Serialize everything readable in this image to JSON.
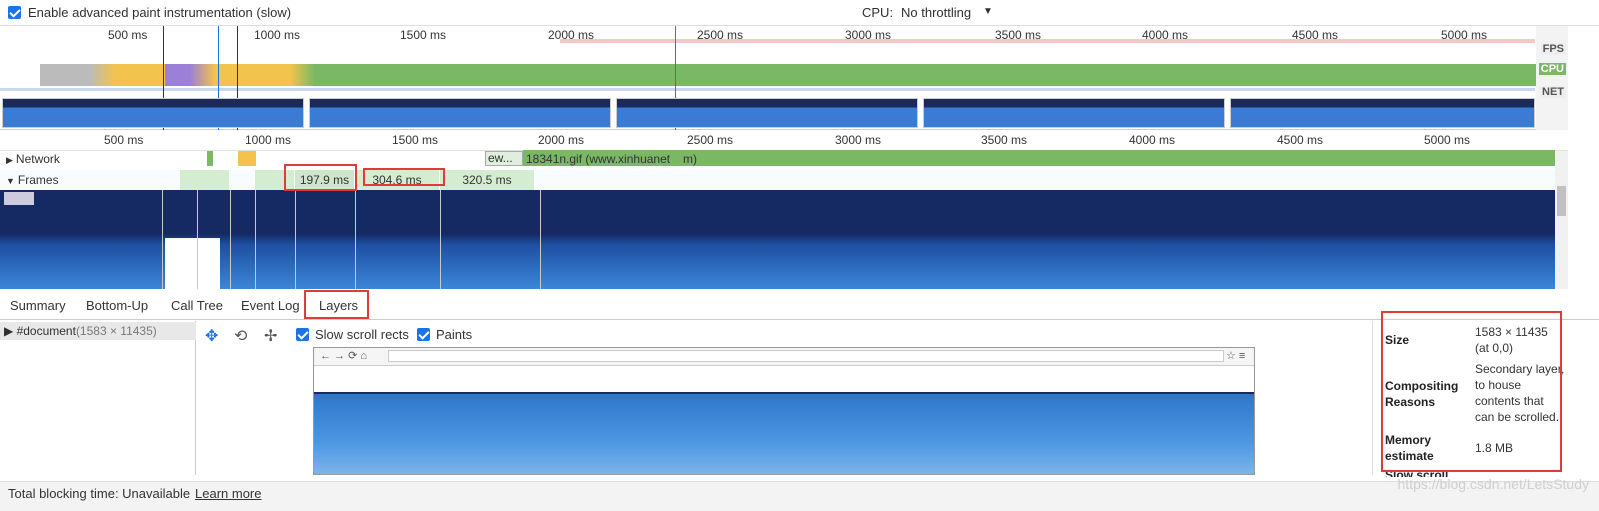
{
  "toolbar": {
    "paint_instrumentation_label": "Enable advanced paint instrumentation (slow)",
    "cpu_label": "CPU:",
    "cpu_value": "No throttling"
  },
  "overview": {
    "ticks": [
      "500 ms",
      "1000 ms",
      "1500 ms",
      "2000 ms",
      "2500 ms",
      "3000 ms",
      "3500 ms",
      "4000 ms",
      "4500 ms",
      "5000 ms"
    ],
    "labels": {
      "fps": "FPS",
      "cpu": "CPU",
      "net": "NET"
    }
  },
  "details_ruler": {
    "ticks": [
      "500 ms",
      "1000 ms",
      "1500 ms",
      "2000 ms",
      "2500 ms",
      "3000 ms",
      "3500 ms",
      "4000 ms",
      "4500 ms",
      "5000 ms"
    ]
  },
  "tracks": {
    "network_label": "Network",
    "frames_label": "Frames",
    "network_request_short": "ew...",
    "network_request": "18341n.gif (www.xinhuanet",
    "network_request_tail": "m)",
    "frames": [
      "197.9 ms",
      "304.6 ms",
      "320.5 ms"
    ]
  },
  "tabs": [
    "Summary",
    "Bottom-Up",
    "Call Tree",
    "Event Log",
    "Layers"
  ],
  "layers": {
    "document_label": "#document",
    "document_size": "(1583 × 11435)",
    "slow_scroll_rects_label": "Slow scroll rects",
    "paints_label": "Paints"
  },
  "details": {
    "size_key": "Size",
    "size_value": "1583 × 11435 (at 0,0)",
    "compositing_key": "Compositing Reasons",
    "compositing_value": "Secondary layer, to house contents that can be scrolled.",
    "memory_key": "Memory estimate",
    "memory_value": "1.8 MB",
    "slow_scroll_key": "Slow scroll"
  },
  "status": {
    "text": "Total blocking time: Unavailable",
    "link": "Learn more"
  },
  "watermark": "https://blog.csdn.net/LetsStudy",
  "colors": {
    "accent": "#1a73e8",
    "cpu_green": "#7ab865",
    "highlight_red": "#e03a3a"
  }
}
